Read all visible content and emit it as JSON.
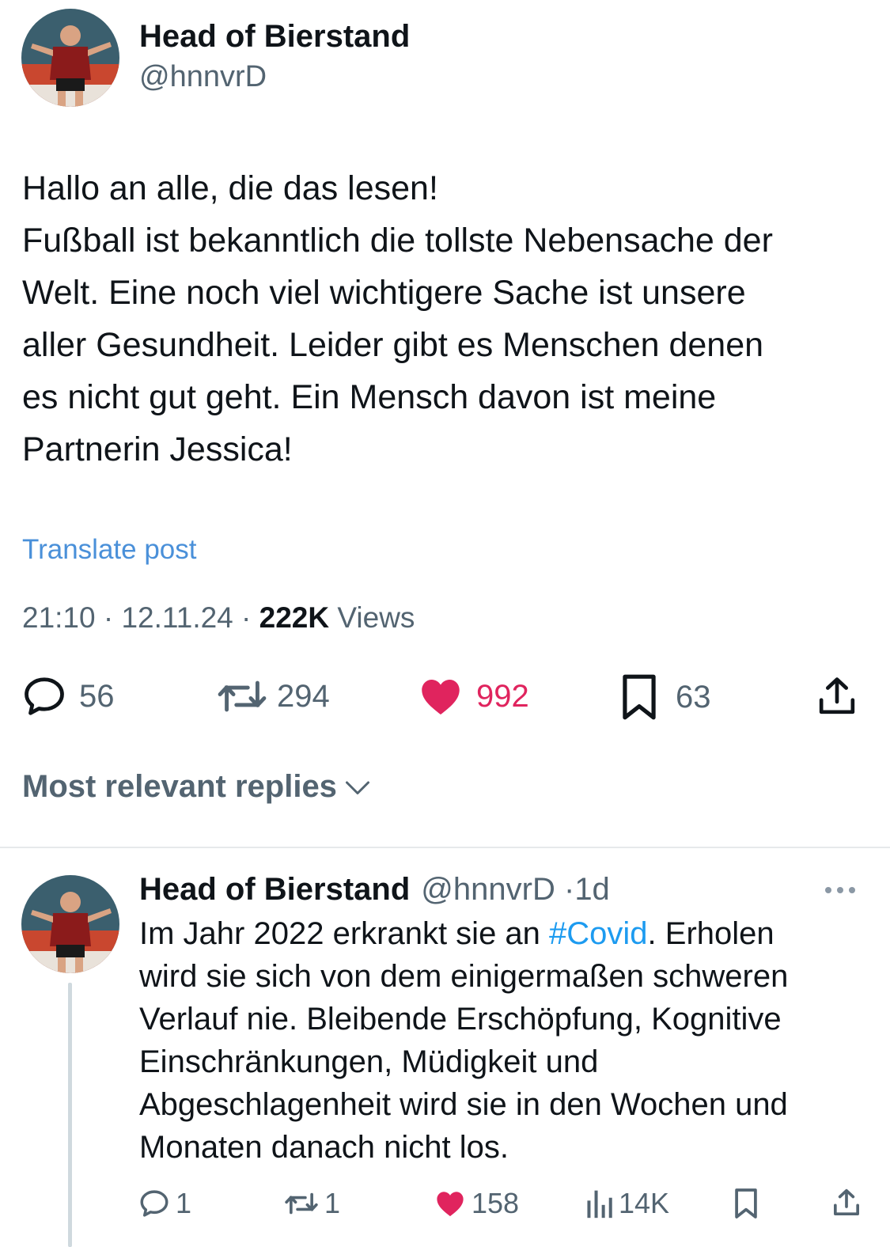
{
  "post": {
    "author_name": "Head of Bierstand",
    "author_handle": "@hnnvrD",
    "text_lines": [
      "Hallo an alle, die das lesen!",
      "Fußball ist bekanntlich die tollste Nebensache der",
      "Welt. Eine noch viel wichtigere Sache ist unsere",
      "aller Gesundheit. Leider gibt es Menschen denen",
      "es nicht gut geht. Ein Mensch davon ist meine",
      "Partnerin Jessica!"
    ],
    "translate_label": "Translate post",
    "time": "21:10",
    "date": "12.11.24",
    "separator": "·",
    "views_count": "222K",
    "views_label": "Views",
    "replies": "56",
    "reposts": "294",
    "likes": "992",
    "bookmarks": "63"
  },
  "sort": {
    "label": "Most relevant replies"
  },
  "reply": {
    "author_name": "Head of Bierstand",
    "author_handle": "@hnnvrD",
    "separator": "·",
    "age": "1d",
    "line1_before": "Im Jahr 2022 erkrankt sie an ",
    "hashtag": "#Covid",
    "line1_after": ". Erholen",
    "text_lines": [
      "wird sie sich von dem einigermaßen schweren",
      "Verlauf nie. Bleibende Erschöpfung, Kognitive",
      "Einschränkungen, Müdigkeit und",
      "Abgeschlagenheit wird sie in den Wochen und",
      "Monaten danach nicht los."
    ],
    "replies": "1",
    "reposts": "1",
    "likes": "158",
    "views": "14K"
  },
  "icons": {
    "reply": "speech-bubble-icon",
    "repost": "repost-icon",
    "like": "heart-icon",
    "bookmark": "bookmark-icon",
    "share": "share-icon",
    "views": "bar-chart-icon",
    "more": "more-dots-icon",
    "chevron": "chevron-down-icon"
  },
  "colors": {
    "like_active": "#e0245e",
    "link": "#1d9bf0",
    "secondary_text": "#536471"
  }
}
